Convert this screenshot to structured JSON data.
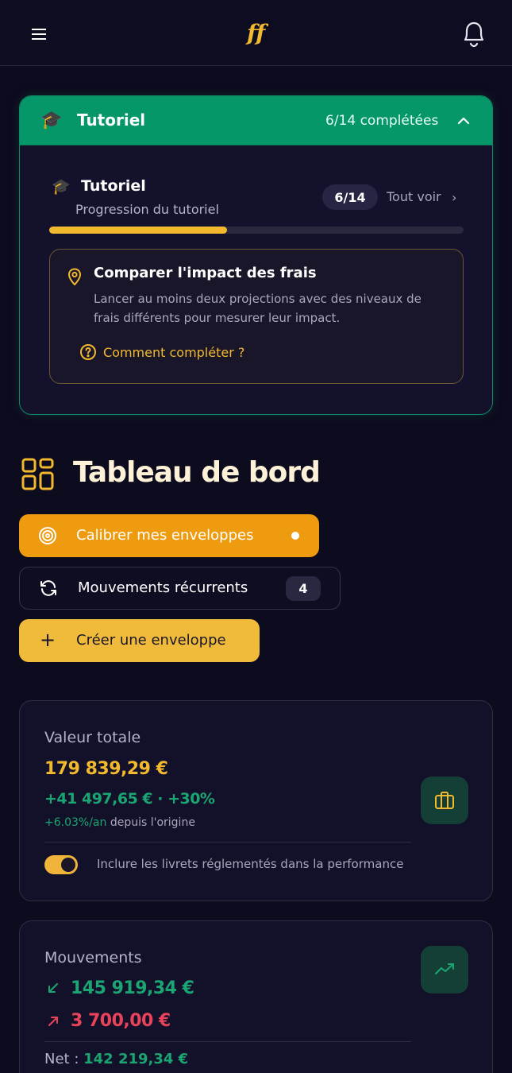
{
  "topbar": {
    "menu_icon": "hamburger-icon",
    "logo_text": "ff",
    "notif_icon": "bell-icon"
  },
  "tutorial": {
    "header_title": "Tutoriel",
    "header_count": "6/14 complétées",
    "header_cap_icon": "🎓",
    "sub_title": "Tutoriel",
    "sub_desc": "Progression du tutoriel",
    "badge": "6/14",
    "see_all": "Tout voir",
    "see_all_chevron": "›",
    "progress": 0.43,
    "task": {
      "title": "Comparer l'impact des frais",
      "desc": "Lancer au moins deux projections avec des niveaux de frais différents pour mesurer leur impact.",
      "help": "Comment compléter ?"
    }
  },
  "dashboard": {
    "title": "Tableau de bord",
    "buttons": {
      "calibrate": "Calibrer mes enveloppes",
      "recurring": "Mouvements récurrents",
      "recurring_count": "4",
      "create_icon": "+",
      "create": "Créer une enveloppe"
    }
  },
  "total_card": {
    "label": "Valeur totale",
    "value": "179 839,29 €",
    "gain": "+41 497,65 € · +30%",
    "annual": "+6.03%/an",
    "annual_rest": " depuis l'origine",
    "toggle_on": true,
    "toggle_label": "Inclure les livrets réglementés dans la performance"
  },
  "movements_card": {
    "label": "Mouvements",
    "inflow": "145 919,34 €",
    "outflow": "3 700,00 €",
    "net_label": "Net : ",
    "net_value": "142 219,34 €"
  },
  "colors": {
    "bg": "#0d0b1e",
    "green": "#059669",
    "gold": "#f2b92f",
    "orange": "#ef9b0f",
    "red": "#e8435a",
    "gain_green": "#1aa572"
  }
}
